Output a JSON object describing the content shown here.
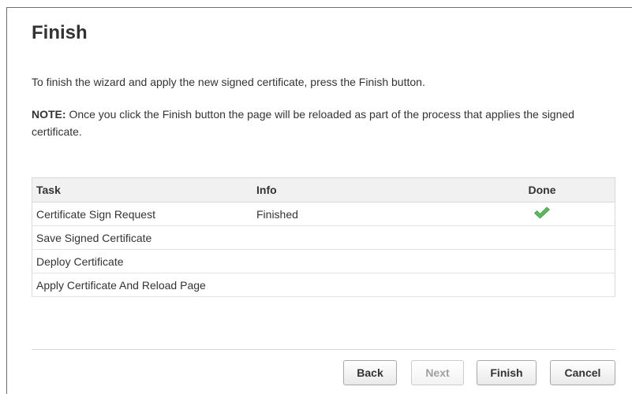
{
  "page": {
    "title": "Finish",
    "intro": "To finish the wizard and apply the new signed certificate, press the Finish button.",
    "note_label": "NOTE:",
    "note_text": " Once you click the Finish button the page will be reloaded as part of the process that applies the signed certificate."
  },
  "table": {
    "headers": {
      "task": "Task",
      "info": "Info",
      "done": "Done"
    },
    "rows": [
      {
        "task": "Certificate Sign Request",
        "info": "Finished",
        "done": true,
        "done_icon": "green-checkmark-icon"
      },
      {
        "task": "Save Signed Certificate",
        "info": "",
        "done": false
      },
      {
        "task": "Deploy Certificate",
        "info": "",
        "done": false
      },
      {
        "task": "Apply Certificate And Reload Page",
        "info": "",
        "done": false
      }
    ]
  },
  "buttons": {
    "back": {
      "label": "Back",
      "enabled": true
    },
    "next": {
      "label": "Next",
      "enabled": false
    },
    "finish": {
      "label": "Finish",
      "enabled": true
    },
    "cancel": {
      "label": "Cancel",
      "enabled": true
    }
  },
  "colors": {
    "text": "#333333",
    "check_green": "#5cb85c",
    "disabled_text": "#a0a0a0",
    "table_header_bg": "#f1f1f1"
  }
}
